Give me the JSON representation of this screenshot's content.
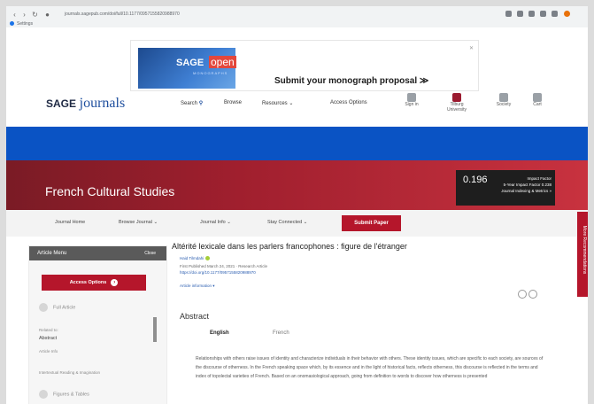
{
  "browser": {
    "url": "journals.sagepub.com/doi/full/10.1177/0957155820988970",
    "bookmark": "Settings"
  },
  "ad": {
    "brand": "SAGE",
    "brand_suffix": "open",
    "tagline": "MONOGRAPHS",
    "text": "Submit your monograph proposal ≫",
    "close": "✕"
  },
  "site": {
    "logo_sage": "SAGE",
    "logo_journals": "journals",
    "nav": [
      "Search",
      "Browse",
      "Resources",
      "Access Options"
    ],
    "icons": [
      {
        "name": "user-icon",
        "label": "Sign in"
      },
      {
        "name": "institution-icon",
        "label": "Tilburg University"
      },
      {
        "name": "society-icon",
        "label": "Society"
      },
      {
        "name": "cart-icon",
        "label": "Cart"
      }
    ]
  },
  "journal": {
    "title": "French Cultural Studies",
    "impact_number": "0.196",
    "impact_label_1": "Impact Factor",
    "impact_label_2": "5-Year Impact Factor 0.238",
    "impact_label_3": "Journal Indexing & Metrics »",
    "nav": [
      "Journal Home",
      "Browse Journal",
      "Journal Info",
      "Stay Connected"
    ],
    "submit": "Submit Paper",
    "sidetab": "More Recommendations"
  },
  "menu": {
    "title": "Article Menu",
    "close": "Close",
    "access": "Access Options",
    "items": [
      "Full Article",
      "Related to:",
      "Abstract",
      "Article Info",
      "Intertextual Reading & Imagination",
      "Figures & Tables"
    ]
  },
  "article": {
    "title": "Altérité lexicale dans les parlers francophones : figure de l'étranger",
    "author": "Haid Tilmdahi",
    "published": "First Published March 24, 2021 · Research Article",
    "doi": "https://doi.org/10.1177/0957155820988970",
    "info": "Article information ▾",
    "abstract_heading": "Abstract",
    "langs": [
      "English",
      "French"
    ],
    "abstract": "Relationships with others raise issues of identity and characterize individuals in their behavior with others. These identity issues, which are specific to each society, are sources of the discourse of otherness. In the French speaking space which, by its essence and in the light of historical facts, reflects otherness, this discourse is reflected in the terms and index of topolectal varieties of French. Based on an onomasiological approach, going from definition to words to discover how otherness is presented"
  }
}
